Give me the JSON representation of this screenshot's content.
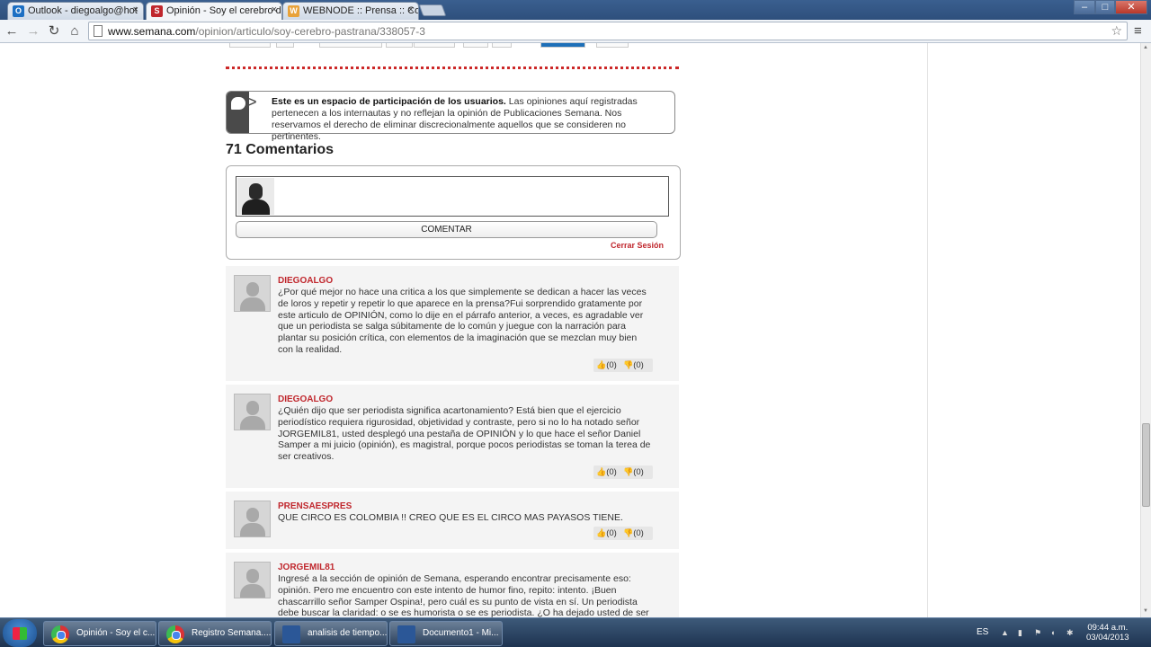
{
  "browser": {
    "tabs": [
      {
        "label": "Outlook - diegoalgo@hot",
        "icon_color": "#1c6fc3",
        "icon_letter": "O"
      },
      {
        "label": "Opinión - Soy el cerebro d",
        "icon_color": "#c0272d",
        "icon_letter": "S"
      },
      {
        "label": "WEBNODE :: Prensa :: Con",
        "icon_color": "#e8a23a",
        "icon_letter": "W"
      }
    ],
    "url_host": "www.semana.com",
    "url_path": "/opinion/articulo/soy-cerebro-pastrana/338057-3",
    "window_controls": {
      "minimize": "–",
      "maximize": "□",
      "close": "✕"
    }
  },
  "notice": {
    "bold_text": "Este es un espacio de participación de los usuarios.",
    "text": " Las opiniones aquí registradas pertenecen a los internautas y no reflejan la opinión de Publicaciones Semana. Nos reservamos el derecho de eliminar discrecionalmente aquellos que se consideren no pertinentes."
  },
  "comments_heading": "71 Comentarios",
  "compose": {
    "button_label": "COMENTAR",
    "logout_label": "Cerrar Sesión"
  },
  "comments": [
    {
      "author": "DIEGOALGO",
      "text": "¿Por qué mejor no hace una critica a los que simplemente se dedican a hacer las veces de loros y repetir y repetir lo que aparece en la prensa?Fui sorprendido gratamente por este articulo de OPINIÓN, como lo dije en el párrafo anterior, a veces, es agradable ver que un periodista se salga súbitamente de lo común y juegue con la narración para plantar su posición crítica, con elementos de la imaginación que se mezclan muy bien con la realidad.",
      "likes": "(0)",
      "dislikes": "(0)"
    },
    {
      "author": "DIEGOALGO",
      "text": "¿Quién dijo que ser periodista significa acartonamiento? Está bien que el ejercicio periodístico requiera rigurosidad, objetividad y contraste, pero si no lo ha notado señor JORGEMIL81, usted desplegó una pestaña de OPINIÓN y lo que hace el señor Daniel Samper a mi juicio (opinión), es magistral, porque pocos periodistas se toman la terea de ser creativos.",
      "likes": "(0)",
      "dislikes": "(0)"
    },
    {
      "author": "PRENSAESPRES",
      "text": "QUE CIRCO ES COLOMBIA !! CREO QUE ES EL CIRCO MAS PAYASOS TIENE.",
      "likes": "(0)",
      "dislikes": "(0)"
    },
    {
      "author": "JORGEMIL81",
      "text": "Ingresé a la sección de opinión de Semana, esperando encontrar precisamente eso: opinión. Pero me encuentro con este intento de humor fino, repito: intento. ¡Buen chascarrillo señor Samper Ospina!, pero cuál es su punto de vista en sí. Un periodista debe buscar la claridad: o se es humorista o se es periodista. ¿O ha dejado usted de ser",
      "likes": "",
      "dislikes": ""
    }
  ],
  "taskbar": {
    "tasks": [
      {
        "label": "Opinión - Soy el c...",
        "icon": "chrome-icon"
      },
      {
        "label": "Registro Semana....",
        "icon": "chrome-icon"
      },
      {
        "label": "analisis de tiempo...",
        "icon": "word-icon"
      },
      {
        "label": "Documento1 - Mi...",
        "icon": "word-icon"
      }
    ],
    "language": "ES",
    "time": "09:44 a.m.",
    "date": "03/04/2013"
  }
}
